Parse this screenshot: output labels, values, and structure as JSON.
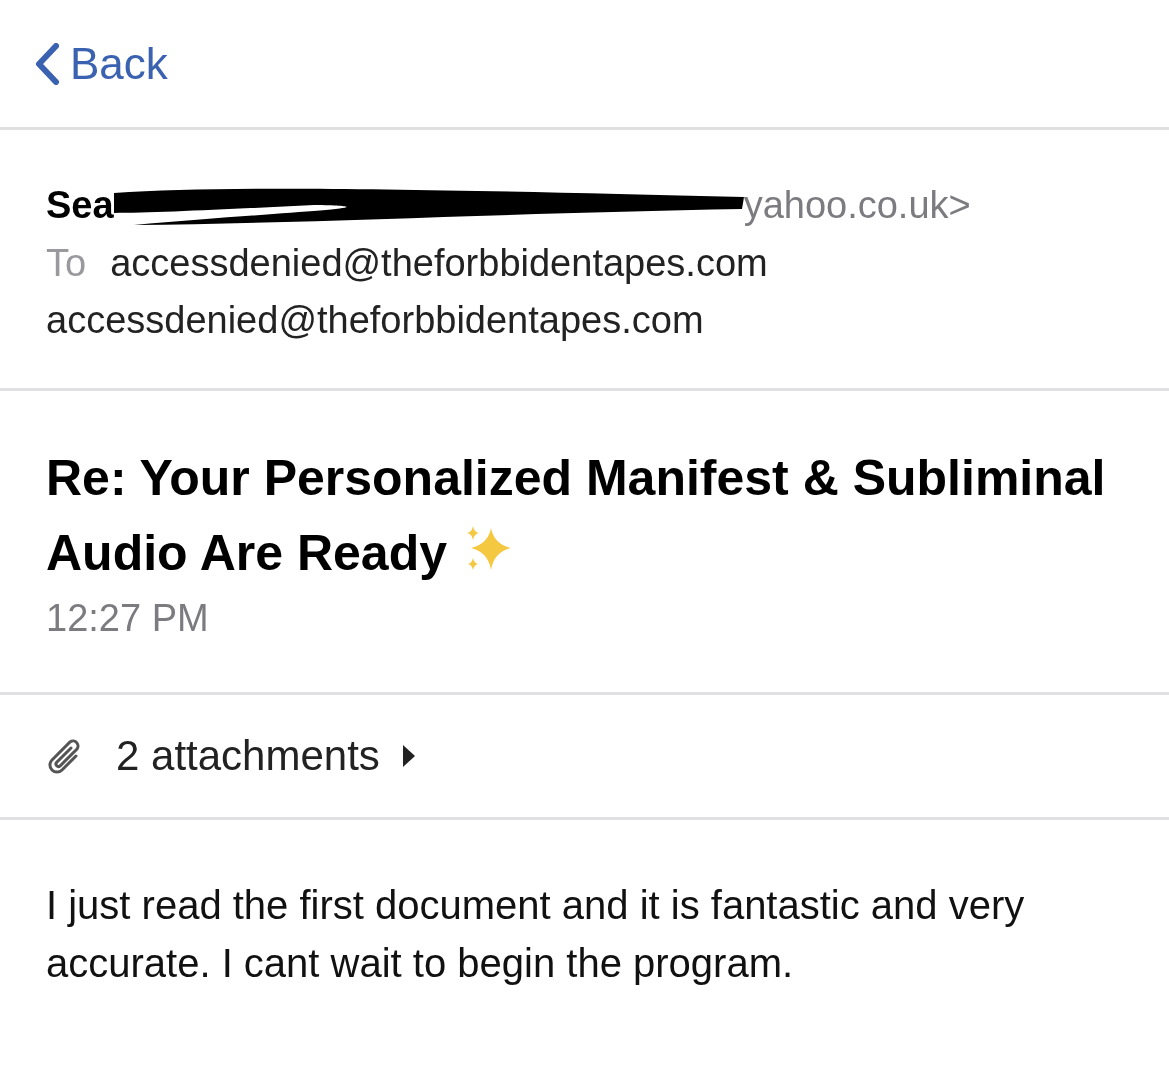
{
  "nav": {
    "back_label": "Back"
  },
  "header": {
    "sender_visible_start": "Sea",
    "sender_visible_end": "yahoo.co.uk>",
    "to_label": "To",
    "to_address": "accessdenied@theforbbidentapes.com",
    "cc_address": "accessdenied@theforbbidentapes.com"
  },
  "subject": {
    "title": "Re: Your Personalized Manifest & Subliminal Audio Are Ready",
    "time": "12:27 PM"
  },
  "attachments": {
    "label": "2 attachments"
  },
  "body": {
    "text": "I just read the first document and it is fantastic and very accurate. I cant wait to begin the program."
  }
}
